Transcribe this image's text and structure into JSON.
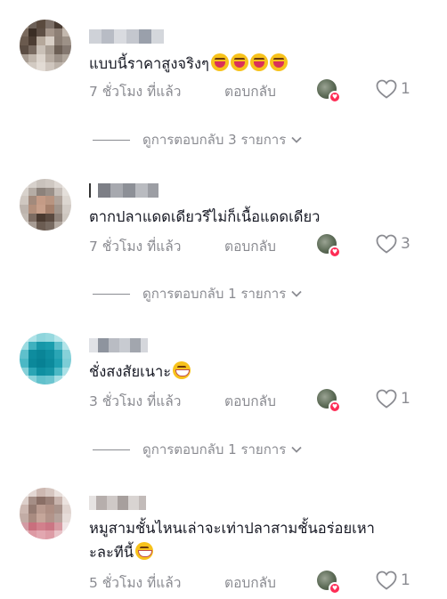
{
  "comments": [
    {
      "text": "แบบนี้ราคาสูงจริงๆ",
      "emoji": [
        "laughing-emoji",
        "laughing-emoji",
        "laughing-emoji",
        "laughing-emoji"
      ],
      "time": "7 ชั่วโมง ที่แล้ว",
      "reply_label": "ตอบกลับ",
      "likes": "1",
      "view_replies": "ดูการตอบกลับ 3 รายการ"
    },
    {
      "text": "ตากปลาแดดเดียวรึไม่ก็เนื้อแดดเดียว",
      "emoji": [],
      "time": "7 ชั่วโมง ที่แล้ว",
      "reply_label": "ตอบกลับ",
      "likes": "3",
      "view_replies": "ดูการตอบกลับ 1 รายการ"
    },
    {
      "text": "ชั่งสงสัยเนาะ",
      "emoji": [
        "grinning-emoji"
      ],
      "time": "3 ชั่วโมง ที่แล้ว",
      "reply_label": "ตอบกลับ",
      "likes": "1",
      "view_replies": "ดูการตอบกลับ 1 รายการ"
    },
    {
      "text_line1": "หมูสามชั้นไหนเล่าจะเท่าปลาสามชั้นอร่อยเหา",
      "text_line2": "ะละทีนี้",
      "emoji": [
        "grinning-emoji"
      ],
      "time": "5 ชั่วโมง ที่แล้ว",
      "reply_label": "ตอบกลับ",
      "likes": "1"
    }
  ],
  "colors": {
    "secondary_text": "#8a8b91",
    "primary_text": "#161823",
    "like_badge": "#fe2c55"
  }
}
